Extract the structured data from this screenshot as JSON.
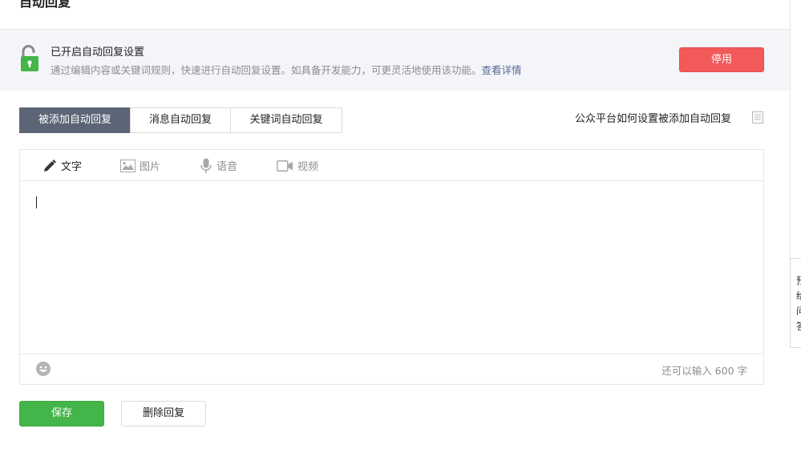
{
  "page": {
    "title": "自动回复"
  },
  "status": {
    "title": "已开启自动回复设置",
    "desc": "通过编辑内容或关键词规则，快速进行自动回复设置。如具备开发能力，可更灵活地使用该功能。",
    "link": "查看详情",
    "disable_label": "停用"
  },
  "tabs": [
    {
      "label": "被添加自动回复"
    },
    {
      "label": "消息自动回复"
    },
    {
      "label": "关键词自动回复"
    }
  ],
  "help": {
    "label": "公众平台如何设置被添加自动回复"
  },
  "editor": {
    "tools": [
      {
        "label": "文字",
        "icon": "pencil-icon"
      },
      {
        "label": "图片",
        "icon": "image-icon"
      },
      {
        "label": "语音",
        "icon": "microphone-icon"
      },
      {
        "label": "视频",
        "icon": "video-icon"
      }
    ],
    "char_count": "还可以输入 600 字"
  },
  "actions": {
    "save_label": "保存",
    "delete_label": "删除回复"
  },
  "side": {
    "chars": [
      "预",
      "给",
      "问",
      "答"
    ]
  },
  "colors": {
    "danger": "#f25a5a",
    "primary": "#44b549",
    "active_tab": "#5b6575",
    "link": "#576b95"
  }
}
